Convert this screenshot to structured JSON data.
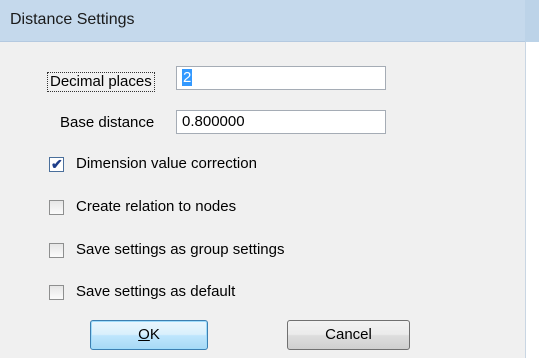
{
  "window": {
    "title": "Distance Settings"
  },
  "fields": {
    "decimal_places": {
      "label": "Decimal places",
      "value": "2"
    },
    "base_distance": {
      "label": "Base distance",
      "value": "0.800000"
    }
  },
  "checkboxes": [
    {
      "label": "Dimension value  correction",
      "checked": true
    },
    {
      "label": "Create relation to nodes",
      "checked": false
    },
    {
      "label": "Save settings as group settings",
      "checked": false
    },
    {
      "label": "Save settings as default",
      "checked": false
    }
  ],
  "buttons": {
    "ok": {
      "mnemonic": "O",
      "rest": "K"
    },
    "cancel": {
      "label": "Cancel"
    }
  },
  "icons": {
    "checkmark": "check-icon"
  },
  "colors": {
    "titlebar": "#c5d9ec",
    "selection": "#3399ff",
    "default_button": "#bee6fd"
  }
}
